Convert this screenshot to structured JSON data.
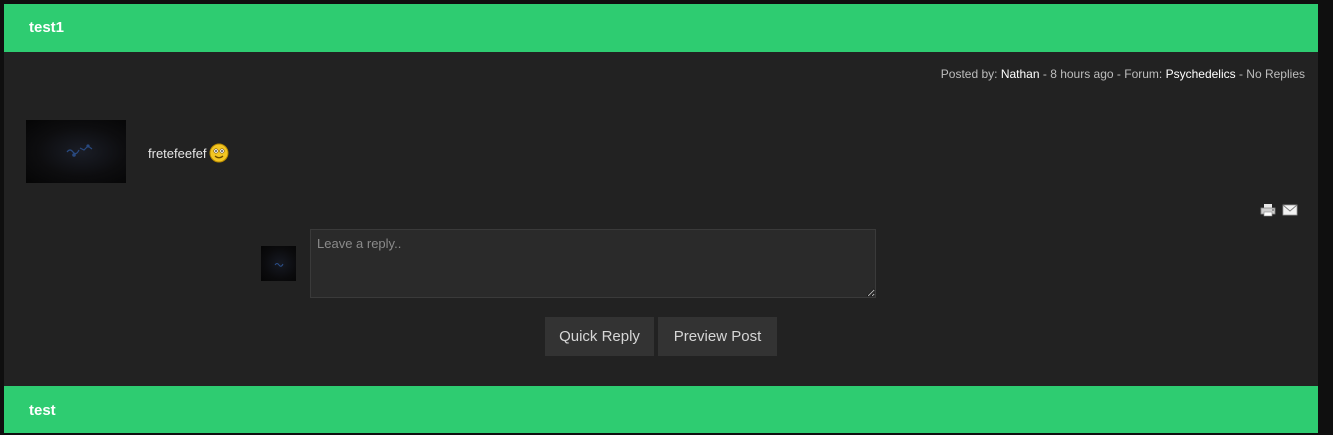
{
  "threads": [
    {
      "title": "test1",
      "meta": {
        "posted_by_label": "Posted by:",
        "author": "Nathan",
        "time_sep": " - ",
        "time": "8 hours ago",
        "forum_sep": " - Forum: ",
        "forum": "Psychedelics",
        "replies_sep": " - ",
        "replies": "No Replies"
      },
      "post_text": "fretefeefef",
      "emoticon": "smiley-icon",
      "tools": [
        "print-icon",
        "email-icon"
      ],
      "reply": {
        "placeholder": "Leave a reply..",
        "value": "",
        "quick_reply_label": "Quick Reply",
        "preview_label": "Preview Post"
      }
    },
    {
      "title": "test"
    }
  ],
  "colors": {
    "accent": "#2ecc71",
    "panel": "#222222",
    "button": "#333333"
  }
}
